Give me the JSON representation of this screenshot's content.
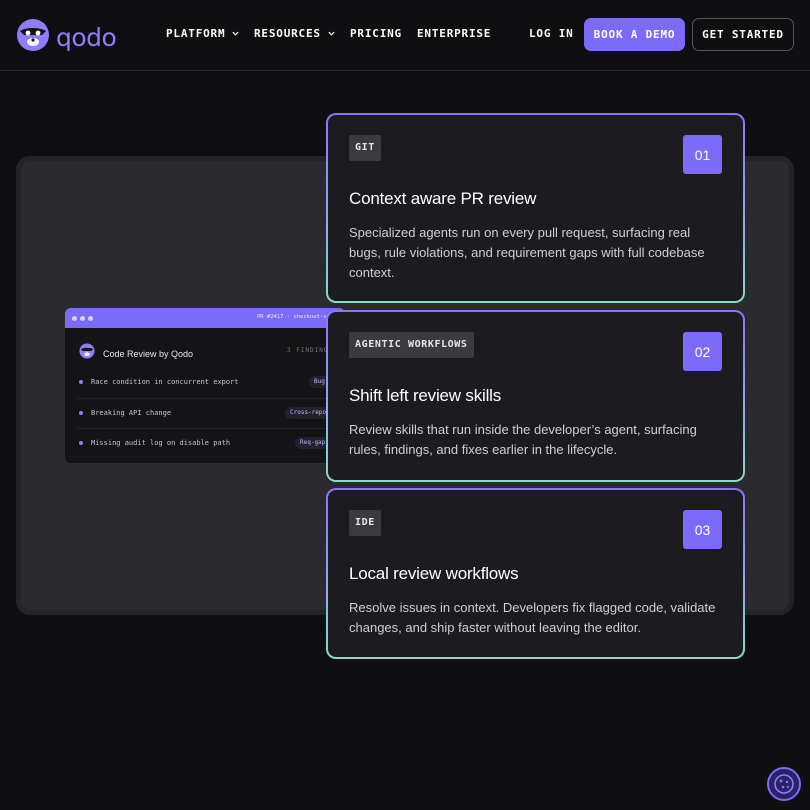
{
  "brand": {
    "name": "qodo",
    "accent": "#7b6bf8"
  },
  "nav": {
    "items": [
      {
        "label": "PLATFORM",
        "has_dropdown": true
      },
      {
        "label": "RESOURCES",
        "has_dropdown": true
      },
      {
        "label": "PRICING",
        "has_dropdown": false
      },
      {
        "label": "ENTERPRISE",
        "has_dropdown": false
      }
    ],
    "login": "LOG IN",
    "book_demo": "BOOK A DEMO",
    "get_started": "GET STARTED"
  },
  "mock": {
    "pr_label": "PR #2417 · checkout-se",
    "title": "Code Review by Qodo",
    "findings": "3 FINDING",
    "rows": [
      {
        "text": "Race condition in concurrent export",
        "tag": "Bug"
      },
      {
        "text": "Breaking API change",
        "tag": "Cross-repo"
      },
      {
        "text": "Missing audit log on disable path",
        "tag": "Req-gap"
      }
    ]
  },
  "cards": [
    {
      "tag": "GIT",
      "number": "01",
      "title": "Context aware PR review",
      "description": "Specialized agents run on every pull request, surfacing real bugs, rule violations, and requirement gaps with full codebase context."
    },
    {
      "tag": "AGENTIC WORKFLOWS",
      "number": "02",
      "title": "Shift left review skills",
      "description": "Review skills that run inside the developer’s agent, surfacing rules, findings, and fixes earlier in the lifecycle."
    },
    {
      "tag": "IDE",
      "number": "03",
      "title": "Local review workflows",
      "description": "Resolve issues in context. Developers fix flagged code, validate changes, and ship faster without leaving the editor."
    }
  ],
  "icons": {
    "logo": "qodo-mascot-icon",
    "cookie": "cookie-icon",
    "dropdown": "chevron-down-icon"
  }
}
